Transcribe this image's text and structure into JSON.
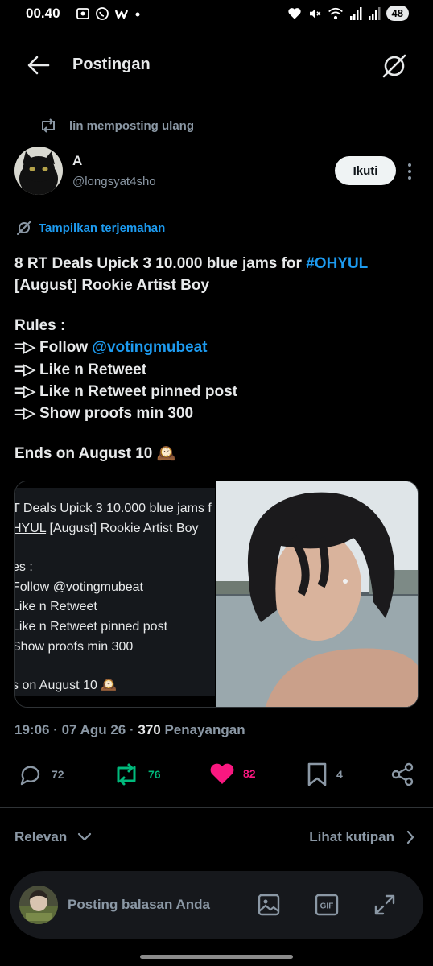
{
  "status_bar": {
    "time": "00.40",
    "battery": "48"
  },
  "header": {
    "title": "Postingan"
  },
  "repost": {
    "text": "lin memposting ulang"
  },
  "author": {
    "name": "A",
    "handle": "@longsyat4sho",
    "follow_label": "Ikuti"
  },
  "translate_label": "Tampilkan terjemahan",
  "tweet": {
    "line1_prefix": "8 RT Deals Upick 3 10.000 blue jams for ",
    "line1_hashtag": "#OHYUL",
    "line2": "[August] Rookie Artist Boy",
    "rules_title": "Rules :",
    "rule1_prefix": "=▷ Follow ",
    "rule1_mention": "@votingmubeat",
    "rule2": "=▷ Like n Retweet",
    "rule3": "=▷ Like n Retweet pinned post",
    "rule4": "=▷ Show proofs min 300",
    "ends": "Ends on August 10 🕰️"
  },
  "embedded_screenshot": {
    "line1": "T Deals Upick 3 10.000 blue jams f",
    "line2_prefix": "HYUL",
    "line2_rest": " [August] Rookie Artist Boy",
    "line3": "es :",
    "line4_prefix": "Follow ",
    "line4_mention": "@votingmubeat",
    "line5": "Like n Retweet",
    "line6": "Like n Retweet pinned post",
    "line7": "Show proofs min 300",
    "line8": "s on August 10 🕰️"
  },
  "meta": {
    "datetime": "19:06 · 07 Agu 26 · ",
    "views_count": "370",
    "views_label": " Penayangan"
  },
  "actions": {
    "replies": "72",
    "reposts": "76",
    "likes": "82",
    "bookmarks": "4"
  },
  "sort": {
    "left_label": "Relevan",
    "right_label": "Lihat kutipan"
  },
  "reply_bar": {
    "placeholder": "Posting balasan Anda",
    "gif_label": "GIF"
  },
  "colors": {
    "background": "#000000",
    "text": "#e7e9ea",
    "muted": "#8b98a5",
    "link": "#1d9bf0",
    "repost_green": "#00ba7c",
    "like_pink": "#f91880"
  }
}
